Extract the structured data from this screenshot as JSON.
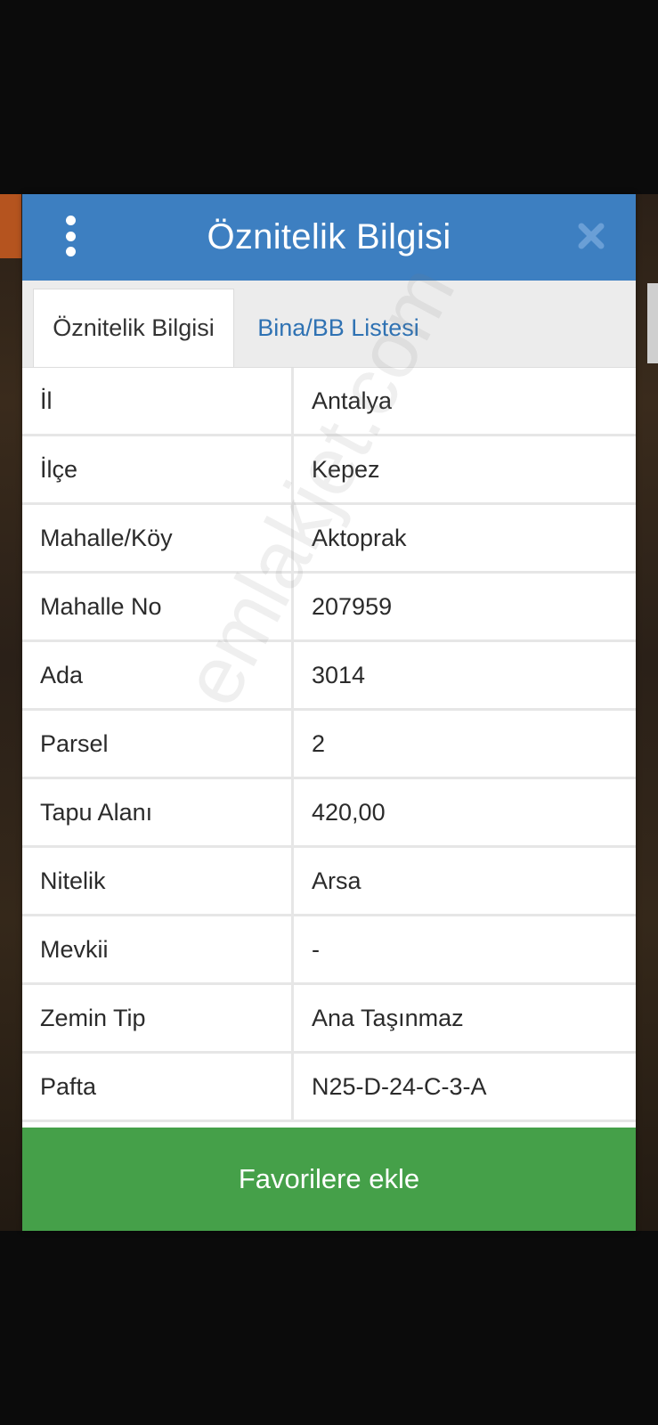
{
  "modal": {
    "title": "Öznitelik Bilgisi",
    "menu_icon": "kebab-menu-icon",
    "close_icon": "close-icon",
    "header_color": "#3d7fc1"
  },
  "tabs": [
    {
      "label": "Öznitelik Bilgisi",
      "active": true
    },
    {
      "label": "Bina/BB Listesi",
      "active": false
    }
  ],
  "attributes": [
    {
      "key": "İl",
      "value": "Antalya"
    },
    {
      "key": "İlçe",
      "value": "Kepez"
    },
    {
      "key": "Mahalle/Köy",
      "value": "Aktoprak"
    },
    {
      "key": "Mahalle No",
      "value": "207959"
    },
    {
      "key": "Ada",
      "value": "3014"
    },
    {
      "key": "Parsel",
      "value": "2"
    },
    {
      "key": "Tapu Alanı",
      "value": "420,00"
    },
    {
      "key": "Nitelik",
      "value": "Arsa"
    },
    {
      "key": "Mevkii",
      "value": "-"
    },
    {
      "key": "Zemin Tip",
      "value": "Ana Taşınmaz"
    },
    {
      "key": "Pafta",
      "value": "N25-D-24-C-3-A"
    }
  ],
  "actions": {
    "favorite_label": "Favorilere ekle",
    "favorite_color": "#45a049"
  },
  "watermark": "emlakjet.com"
}
